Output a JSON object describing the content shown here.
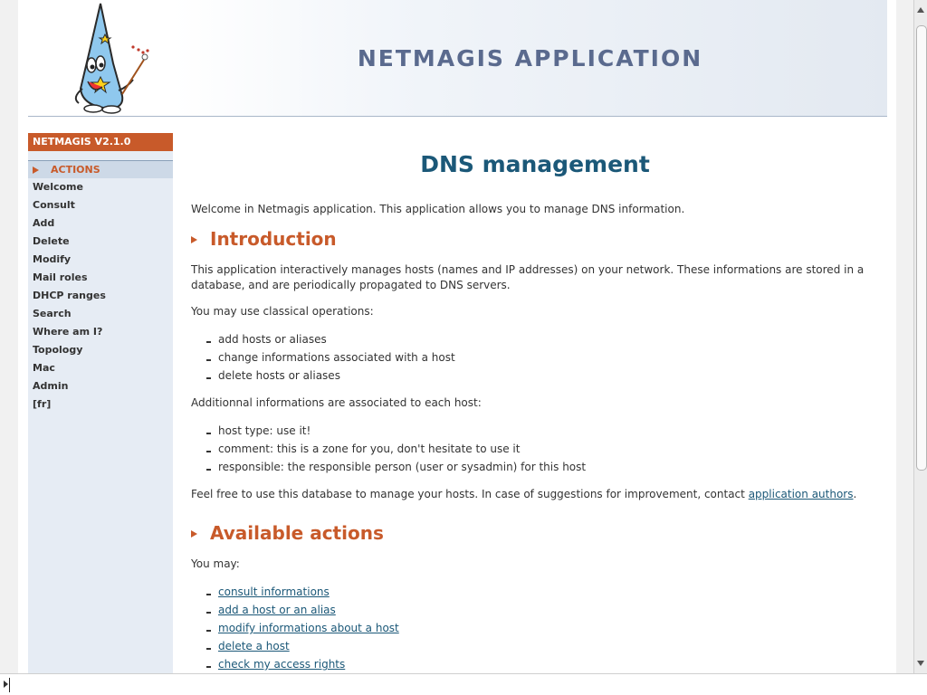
{
  "header": {
    "app_title": "NETMAGIS APPLICATION"
  },
  "sidebar": {
    "version": "NETMAGIS V2.1.0",
    "actions_label": "ACTIONS",
    "items": [
      {
        "label": "Welcome"
      },
      {
        "label": "Consult"
      },
      {
        "label": "Add"
      },
      {
        "label": "Delete"
      },
      {
        "label": "Modify"
      },
      {
        "label": "Mail roles"
      },
      {
        "label": "DHCP ranges"
      },
      {
        "label": "Search"
      },
      {
        "label": "Where am I?"
      },
      {
        "label": "Topology"
      },
      {
        "label": "Mac"
      },
      {
        "label": "Admin"
      },
      {
        "label": "[fr]"
      }
    ]
  },
  "main": {
    "title": "DNS management",
    "welcome": "Welcome in Netmagis application. This application allows you to manage DNS information.",
    "intro_heading": "Introduction",
    "intro_text": "This application interactively manages hosts (names and IP addresses) on your network. These informations are stored in a database, and are periodically propagated to DNS servers.",
    "classical_text": "You may use classical operations:",
    "classical_ops": [
      "add hosts or aliases",
      "change informations associated with a host",
      "delete hosts or aliases"
    ],
    "additional_text": "Additionnal informations are associated to each host:",
    "additional_items": [
      "host type: use it!",
      "comment: this is a zone for you, don't hesitate to use it",
      "responsible: the responsible person (user or sysadmin) for this host"
    ],
    "feedback_prefix": "Feel free to use this database to manage your hosts. In case of suggestions for improvement, contact ",
    "feedback_link": "application authors",
    "feedback_suffix": ".",
    "actions_heading": "Available actions",
    "you_may": "You may:",
    "action_links": [
      "consult informations",
      "add a host or an alias",
      "modify informations about a host",
      "delete a host",
      "check my access rights"
    ]
  },
  "colors": {
    "accent": "#c85a2a",
    "title_blue": "#1b5878",
    "sidebar_bg": "#e6ecf4",
    "banner_text": "#5a6a8e"
  }
}
